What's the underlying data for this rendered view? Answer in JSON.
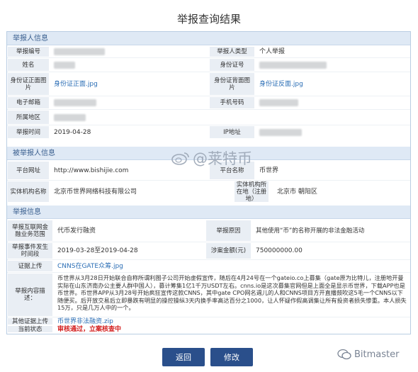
{
  "title": "举报查询结果",
  "sections": {
    "reporter": "举报人信息",
    "reported": "被举报人信息",
    "report": "举报信息"
  },
  "reporter": {
    "report_no_label": "举报编号",
    "reporter_type_label": "举报人类型",
    "reporter_type_value": "个人举报",
    "name_label": "姓名",
    "id_no_label": "身份证号",
    "id_front_label": "身份证正面图片",
    "id_front_value": "身份证正面.jpg",
    "id_back_label": "身份证背面图片",
    "id_back_value": "身份证反面.jpg",
    "email_label": "电子邮箱",
    "phone_label": "手机号码",
    "region_label": "所属地区",
    "report_time_label": "举报时间",
    "report_time_value": "2019-04-28",
    "ip_label": "IP地址"
  },
  "reported": {
    "platform_url_label": "平台网址",
    "platform_url_value": "http://www.bishijie.com",
    "platform_name_label": "平台名称",
    "platform_name_value": "币世界",
    "entity_label": "实体机构名称",
    "entity_value": "北京币世界网络科技有限公司",
    "entity_location_label": "实体机构所在地（注册地）",
    "entity_location_value": "北京市 朝阳区"
  },
  "report": {
    "business_type_label": "举报互联网金融业务范围",
    "business_type_value": "代币发行融资",
    "reason_label": "举报原因",
    "reason_value": "其他使用“币”的名称开展的非法金融活动",
    "event_time_label": "举报事件发生时间段",
    "event_time_value": "2019-03-28至2019-04-28",
    "amount_label": "涉案金额(元)",
    "amount_value": "750000000.00",
    "evidence_label": "证据上传",
    "evidence_value": "CNNS在GATE众筹.jpg",
    "content_label": "举报内容描述：",
    "content_value": "币世界从3月28日开始联合自称所谓利图子公司开始虚假宣传，随后在4月24号在一个gateio.co上募集（gate原为比特儿，注册地开曼实际在山东济南办公主要人群中国人），募计筹集1亿1千万USDT左右。cnns.io是这次募集官网但是上面全是显示币世界，下载APP也是币世界。币世界APP从3月28号开始疯狂宣传这款CNNS，其中gate CPO网名週儿的人和CNNS项目方开直播鼓吹这5毛一个CNNS以下随便买。后开放交易后立即暴跌有明显的操控操纵3天内换手率高达百分之1000，让人怀疑作假高调集让所有投资者损失惨重。本人损失15万，只是几万人中的一个。",
    "other_evidence_label": "其他证据上传",
    "other_evidence_value": "币世界非法融资.zip",
    "status_label": "当前状态",
    "status_value": "审核通过，立案核查中"
  },
  "buttons": {
    "back": "返回",
    "edit": "修改"
  },
  "watermarks": {
    "weibo": "@莱特币",
    "bitmaster": "Bitmaster"
  }
}
